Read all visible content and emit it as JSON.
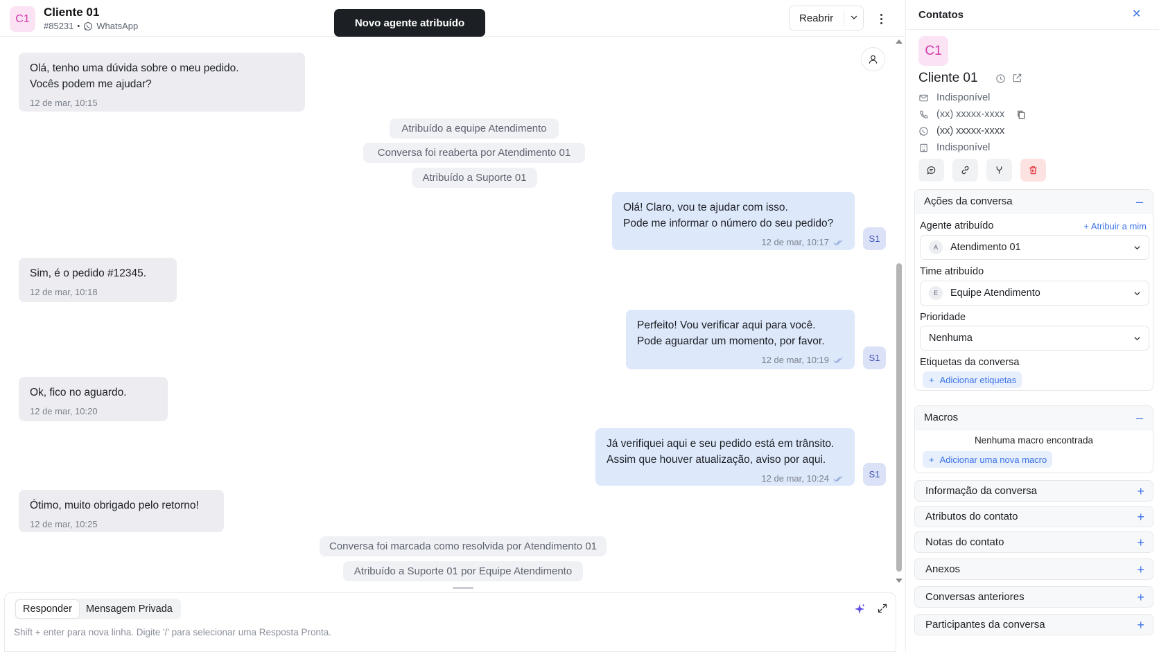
{
  "header": {
    "avatar_initials": "C1",
    "contact_name": "Cliente 01",
    "ticket_id": "#85231",
    "channel": "WhatsApp",
    "toast": "Novo agente atribuído",
    "reopen_label": "Reabrir"
  },
  "messages": [
    {
      "dir": "in",
      "text": "Olá, tenho uma dúvida sobre o meu pedido.\nVocês podem me ajudar?",
      "time": "12 de mar, 10:15"
    },
    {
      "dir": "out",
      "text": "Olá! Claro, vou te ajudar com isso.\nPode me informar o número do seu pedido?",
      "time": "12 de mar, 10:17",
      "agent": "S1"
    },
    {
      "dir": "in",
      "text": "Sim, é o pedido #12345.",
      "time": "12 de mar, 10:18"
    },
    {
      "dir": "out",
      "text": "Perfeito! Vou verificar aqui para você.\nPode aguardar um momento, por favor.",
      "time": "12 de mar, 10:19",
      "agent": "S1"
    },
    {
      "dir": "in",
      "text": "Ok, fico no aguardo.",
      "time": "12 de mar, 10:20"
    },
    {
      "dir": "out",
      "text": "Já verifiquei aqui e seu pedido está em trânsito.\nAssim que houver atualização, aviso por aqui.",
      "time": "12 de mar, 10:24",
      "agent": "S1"
    },
    {
      "dir": "in",
      "text": "Ótimo, muito obrigado pelo retorno!",
      "time": "12 de mar, 10:25"
    }
  ],
  "events": [
    "Atribuído a equipe Atendimento",
    "Conversa foi reaberta por Atendimento 01",
    "Atribuído a Suporte 01",
    "Conversa foi marcada como resolvida por Atendimento 01",
    "Atribuído a Suporte 01 por Equipe Atendimento"
  ],
  "composer": {
    "tab_reply": "Responder",
    "tab_private": "Mensagem Privada",
    "placeholder": "Shift + enter para nova linha. Digite '/' para selecionar uma Resposta Pronta."
  },
  "sidebar": {
    "title": "Contatos",
    "contact": {
      "initials": "C1",
      "name": "Cliente 01",
      "email": "Indisponível",
      "phone": "(xx) xxxxx-xxxx",
      "whatsapp": "(xx) xxxxx-xxxx",
      "company": "Indisponível"
    },
    "conversation_actions": {
      "title": "Ações da conversa",
      "agent_label": "Agente atribuído",
      "assign_me": "Atribuir a mim",
      "agent_initial": "A",
      "agent_value": "Atendimento 01",
      "team_label": "Time atribuído",
      "team_initial": "E",
      "team_value": "Equipe Atendimento",
      "priority_label": "Prioridade",
      "priority_value": "Nenhuma",
      "labels_label": "Etiquetas da conversa",
      "add_labels": "Adicionar etiquetas"
    },
    "macros": {
      "title": "Macros",
      "empty": "Nenhuma macro encontrada",
      "add": "Adicionar uma nova macro"
    },
    "sections": [
      "Informação da conversa",
      "Atributos do contato",
      "Notas do contato",
      "Anexos",
      "Conversas anteriores",
      "Participantes da conversa"
    ]
  },
  "colors": {
    "accent": "#3b72e8",
    "incoming_bubble": "#ececf1",
    "outgoing_bubble": "#dde8fb",
    "avatar_pink": "#fbe3f4",
    "toast_bg": "#1c2024"
  }
}
